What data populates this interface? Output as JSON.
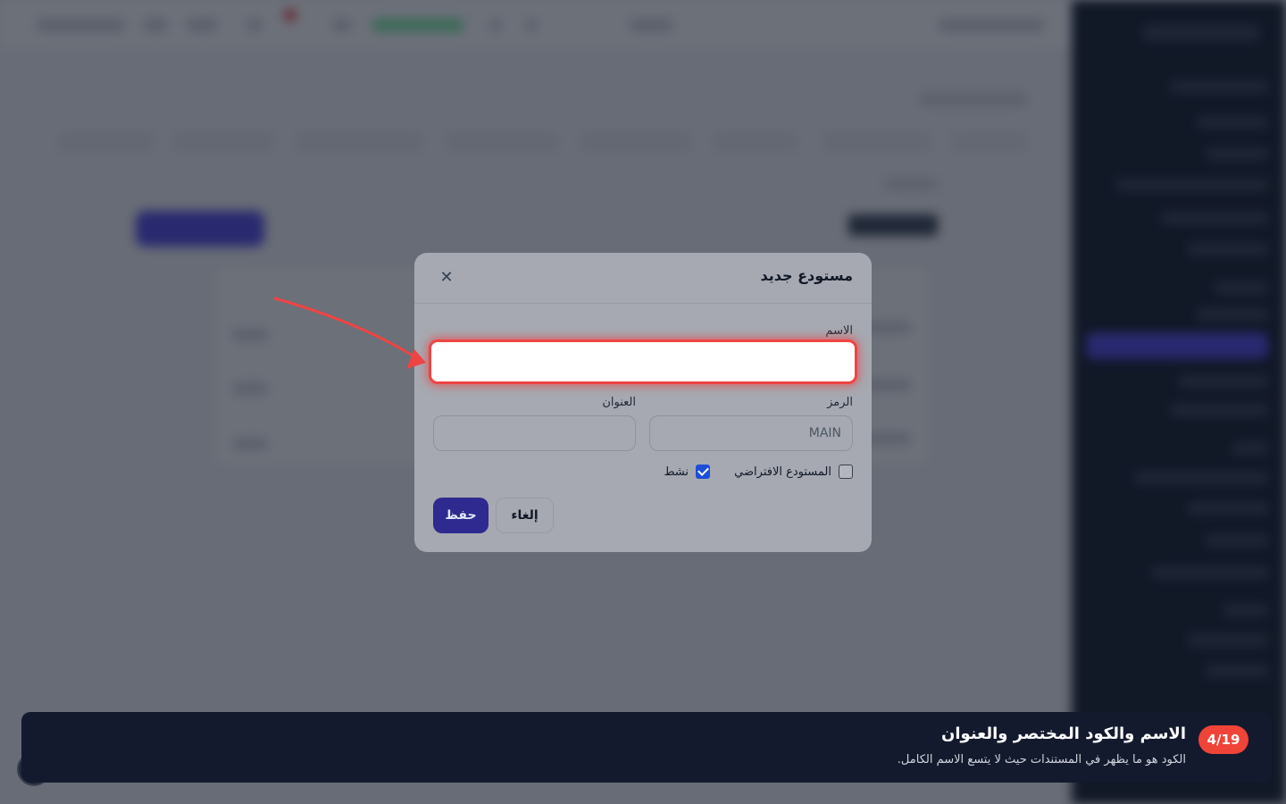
{
  "modal": {
    "title": "مستودع جديد",
    "close_icon": "close-icon",
    "name_label": "الاسم",
    "name_value": "",
    "code_label": "الرمز",
    "code_placeholder": "MAIN",
    "address_label": "العنوان",
    "address_value": "",
    "default_checkbox_label": "المستودع الافتراضي",
    "default_checked": false,
    "active_checkbox_label": "نشط",
    "active_checked": true,
    "save_label": "حفظ",
    "cancel_label": "إلغاء"
  },
  "tour": {
    "step": "4/19",
    "title": "الاسم والكود المختصر والعنوان",
    "description": "الكود هو ما يظهر في المستندات حيث لا يتسع الاسم الكامل."
  },
  "colors": {
    "highlight": "#ef4444",
    "primary": "#4f46e5",
    "tour_bg": "#141a2e",
    "badge": "#f04438"
  }
}
